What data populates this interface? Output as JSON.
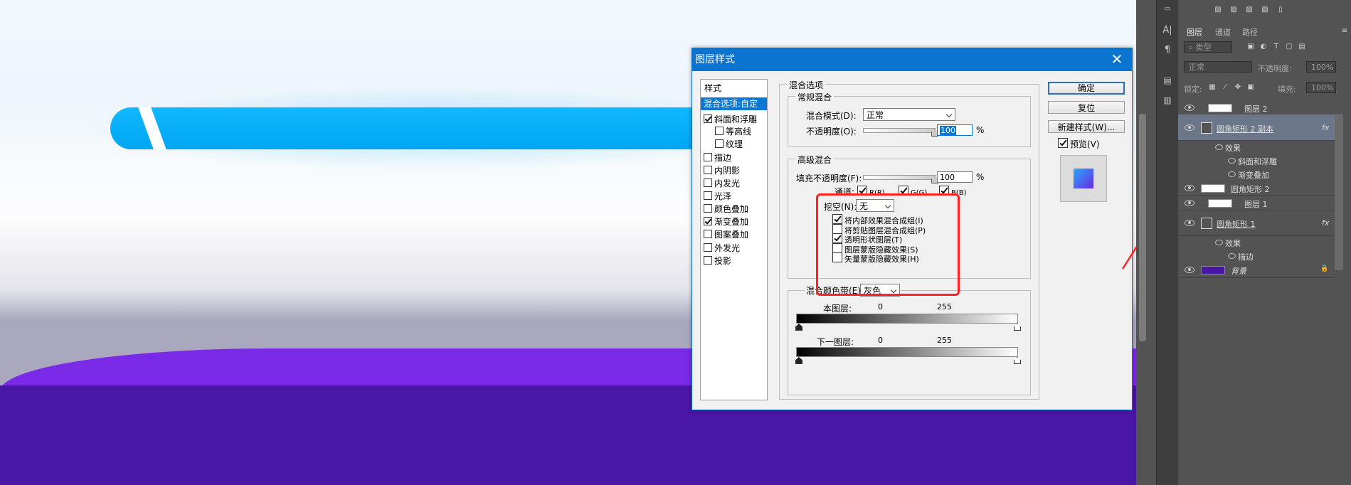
{
  "dialog": {
    "title": "图层样式",
    "close_glyph": "✕",
    "styles_header": "样式",
    "styles": [
      {
        "label": "混合选项:自定",
        "checkbox": false,
        "checked": false,
        "selected": true
      },
      {
        "label": "斜面和浮雕",
        "checkbox": true,
        "checked": true
      },
      {
        "label": "等高线",
        "checkbox": true,
        "checked": false,
        "indent": true
      },
      {
        "label": "纹理",
        "checkbox": true,
        "checked": false,
        "indent": true
      },
      {
        "label": "描边",
        "checkbox": true,
        "checked": false
      },
      {
        "label": "内阴影",
        "checkbox": true,
        "checked": false
      },
      {
        "label": "内发光",
        "checkbox": true,
        "checked": false
      },
      {
        "label": "光泽",
        "checkbox": true,
        "checked": false
      },
      {
        "label": "颜色叠加",
        "checkbox": true,
        "checked": false
      },
      {
        "label": "渐变叠加",
        "checkbox": true,
        "checked": true
      },
      {
        "label": "图案叠加",
        "checkbox": true,
        "checked": false
      },
      {
        "label": "外发光",
        "checkbox": true,
        "checked": false
      },
      {
        "label": "投影",
        "checkbox": true,
        "checked": false
      }
    ],
    "blend_options_title": "混合选项",
    "general_title": "常规混合",
    "blend_mode_label": "混合模式(D):",
    "blend_mode_value": "正常",
    "opacity_label": "不透明度(O):",
    "opacity_value": "100",
    "percent": "%",
    "advanced_title": "高级混合",
    "fill_opacity_label": "填充不透明度(F):",
    "fill_opacity_value": "100",
    "channels_label": "通道:",
    "channel_r": "R(R)",
    "channel_g": "G(G)",
    "channel_b": "B(B)",
    "knockout_label": "挖空(N):",
    "knockout_value": "无",
    "adv_options": [
      {
        "label": "将内部效果混合成组(I)",
        "checked": true
      },
      {
        "label": "将剪贴图层混合成组(P)",
        "checked": false
      },
      {
        "label": "透明形状图层(T)",
        "checked": true
      },
      {
        "label": "图层蒙版隐藏效果(S)",
        "checked": false
      },
      {
        "label": "矢量蒙版隐藏效果(H)",
        "checked": false
      }
    ],
    "blend_if_label": "混合颜色带(E):",
    "blend_if_value": "灰色",
    "this_layer_label": "本图层:",
    "underlying_label": "下一图层:",
    "range_min": "0",
    "range_max": "255",
    "ok_label": "确定",
    "reset_label": "复位",
    "new_style_label": "新建样式(W)...",
    "preview_label": "预览(V)"
  },
  "colors": {
    "canvas_bar": "#00a6f2",
    "canvas_purple": "#4a16a6",
    "accent": "#0a78d7",
    "highlight_box": "#ff2222"
  },
  "layers_panel": {
    "tabs": [
      "图层",
      "通道",
      "路径"
    ],
    "filter_label": "类型",
    "blend_mode": "正常",
    "opacity_label": "不透明度:",
    "opacity_value": "100%",
    "lock_label": "锁定:",
    "fill_label": "填充:",
    "fill_value": "100%",
    "fx": "fx",
    "effects_label": "效果",
    "rows": [
      {
        "name": "图层 2",
        "kind": "layer"
      },
      {
        "name": "圆角矩形 2 副本",
        "kind": "shape",
        "selected": true
      },
      {
        "name": "斜面和浮雕",
        "kind": "effect"
      },
      {
        "name": "渐变叠加",
        "kind": "effect"
      },
      {
        "name": "圆角矩形 2",
        "kind": "layer"
      },
      {
        "name": "图层 1",
        "kind": "layer"
      },
      {
        "name": "圆角矩形 1",
        "kind": "shape"
      },
      {
        "name": "描边",
        "kind": "effect"
      },
      {
        "name": "背景",
        "kind": "background"
      }
    ]
  },
  "dock_icons": [
    "A|",
    "¶"
  ]
}
